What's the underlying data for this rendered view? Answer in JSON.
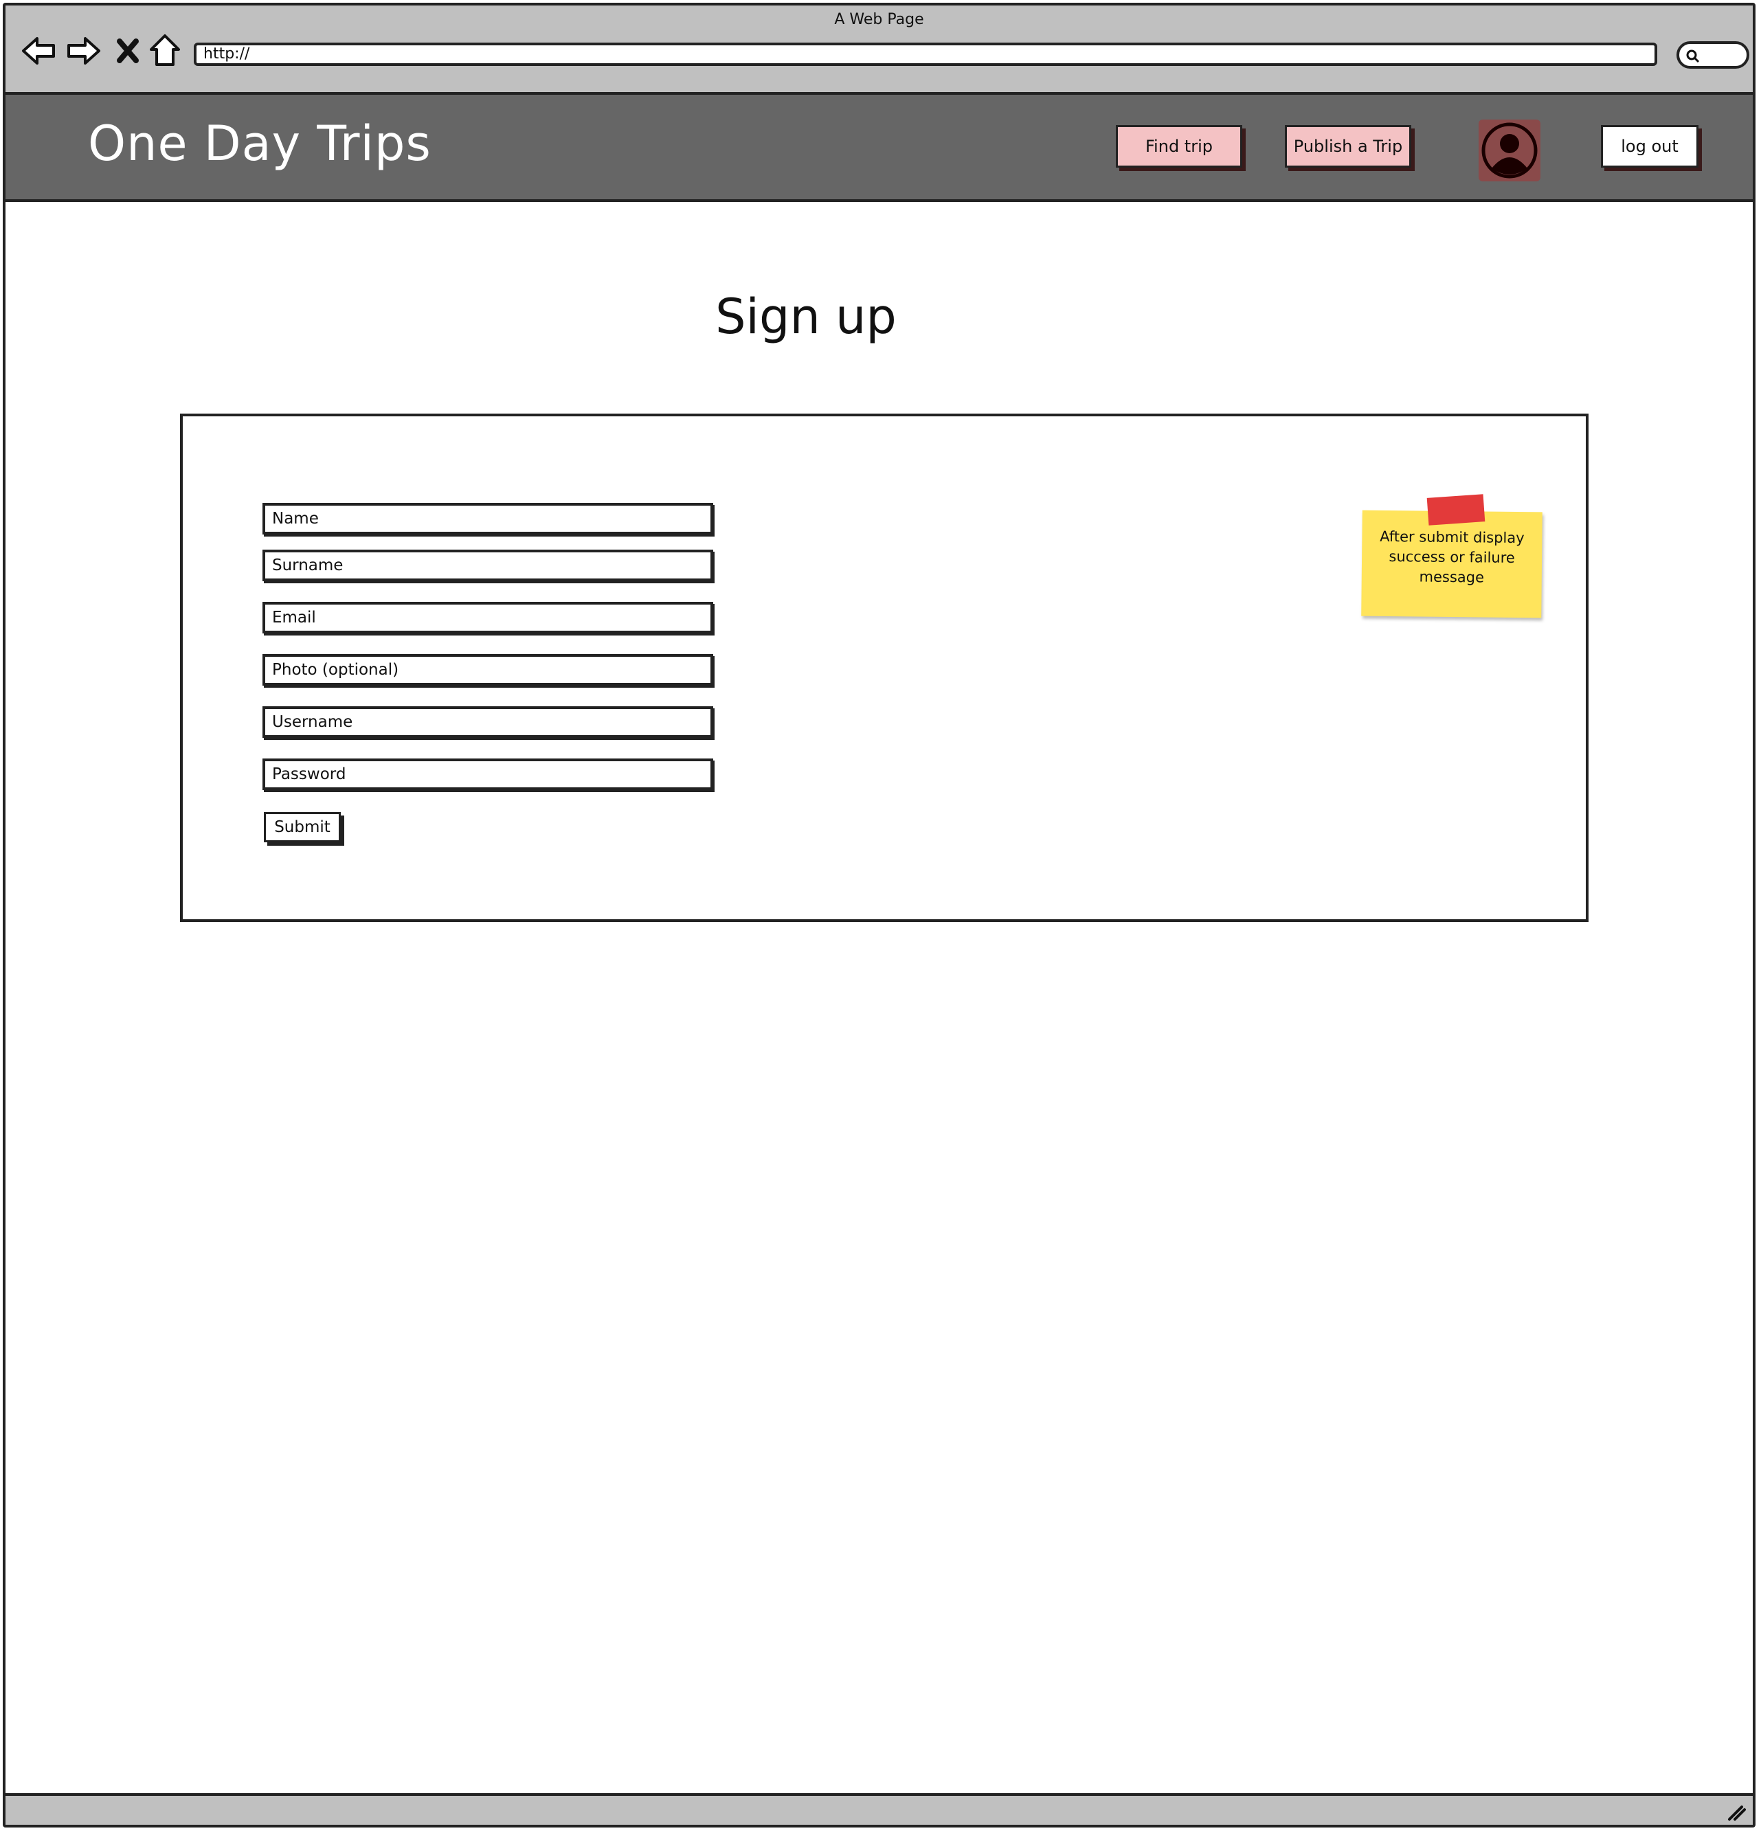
{
  "browser": {
    "window_title": "A Web Page",
    "url": "http://"
  },
  "header": {
    "brand": "One Day Trips",
    "nav": {
      "find_trip": "Find trip",
      "publish_trip": "Publish a Trip",
      "logout": "log out"
    },
    "avatar_icon": "user-avatar-icon"
  },
  "page": {
    "title": "Sign up"
  },
  "form": {
    "fields": {
      "name": "Name",
      "surname": "Surname",
      "email": "Email",
      "photo": "Photo (optional)",
      "username": "Username",
      "password": "Password"
    },
    "submit_label": "Submit"
  },
  "note": {
    "line1": "After submit display",
    "line2": "success or failure",
    "line3": "message"
  },
  "colors": {
    "header_bg": "#666666",
    "button_pink": "#f4c2c4",
    "sticky_yellow": "#ffe45c",
    "sticky_tape": "#e33a3a",
    "chrome_gray": "#c0c0c0"
  }
}
